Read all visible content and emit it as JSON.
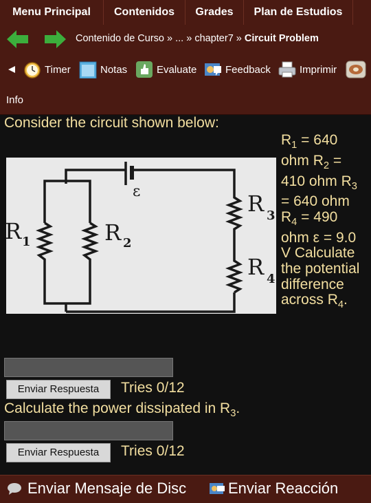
{
  "nav": {
    "tabs": [
      "Menu Principal",
      "Contenidos",
      "Grades",
      "Plan de Estudios"
    ]
  },
  "breadcrumb": {
    "root": "Contenido de Curso",
    "sep1": " » ... » ",
    "chapter": "chapter7",
    "sep2": " » ",
    "current": "Circuit Problem"
  },
  "toolbar": {
    "timer": "Timer",
    "notas": "Notas",
    "evaluate": "Evaluate",
    "feedback": "Feedback",
    "imprimir": "Imprimir"
  },
  "info": "Info",
  "question1": {
    "intro": "Consider the circuit shown below:",
    "r1_val": " = 640 ohm ",
    "r2_val": " = 410 ohm ",
    "r3_val": " = 640 ohm ",
    "r4_val": " = 490 ohm ε = 9.0 V Calculate the potential difference across ",
    "end": ".",
    "sym_r": "R",
    "sub1": "1",
    "sub2": "2",
    "sub3": "3",
    "sub4": "4"
  },
  "figure": {
    "r1": "R",
    "s1": "1",
    "r2": "R",
    "s2": "2",
    "r3": "R",
    "s3": "3",
    "r4": "R",
    "s4": "4",
    "emf": "ε"
  },
  "answer1": {
    "value": "",
    "button": "Enviar Respuesta",
    "tries": "Tries 0/12"
  },
  "question2": {
    "text": "Calculate the power dissipated in R",
    "sub": "3",
    "end": "."
  },
  "answer2": {
    "value": "",
    "button": "Enviar Respuesta",
    "tries": "Tries 0/12"
  },
  "bottom": {
    "send_message": "Enviar Mensaje de Disc",
    "send_feedback": "Enviar Reacción"
  },
  "colors": {
    "header": "#4a1a12",
    "text": "#f3dfa0",
    "arrow": "#3cae3c"
  }
}
